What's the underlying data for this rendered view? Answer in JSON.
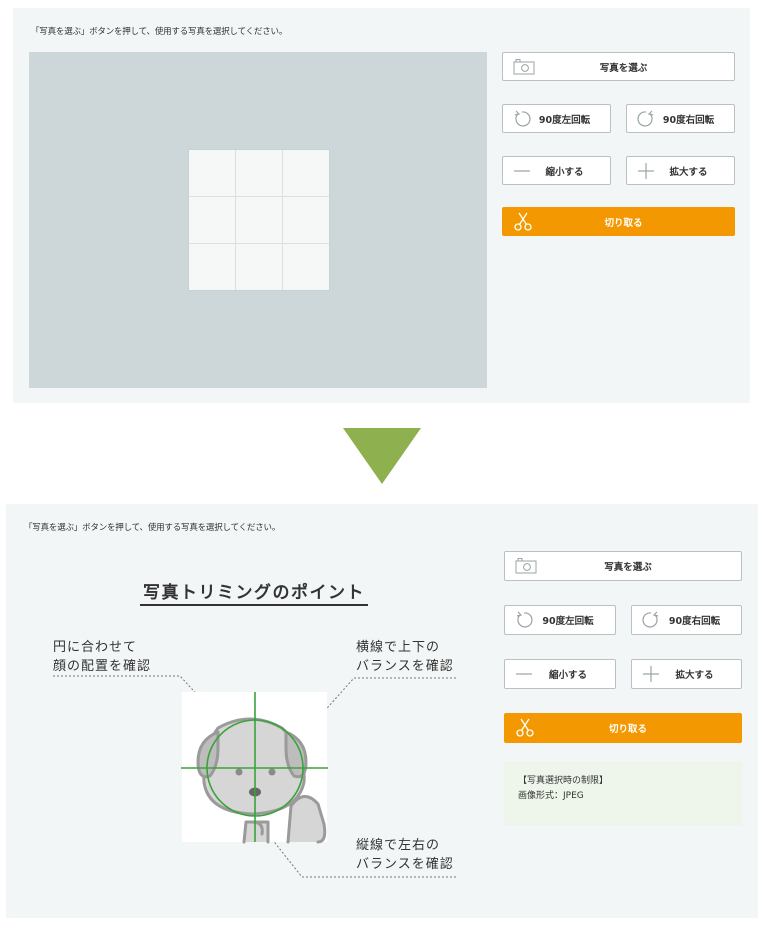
{
  "instruction": "「写真を選ぶ」ボタンを押して、使用する写真を選択してください。",
  "buttons": {
    "choose_photo": "写真を選ぶ",
    "rotate_left": "90度左回転",
    "rotate_right": "90度右回転",
    "shrink": "縮小する",
    "enlarge": "拡大する",
    "crop": "切り取る"
  },
  "guide": {
    "title": "写真トリミングのポイント",
    "note_face_1": "円に合わせて",
    "note_face_2": "顔の配置を確認",
    "note_horizontal_1": "横線で上下の",
    "note_horizontal_2": "バランスを確認",
    "note_vertical_1": "縦線で左右の",
    "note_vertical_2": "バランスを確認"
  },
  "restriction": {
    "heading": "【写真選択時の制限】",
    "format": "画像形式：JPEG"
  },
  "colors": {
    "accent_orange": "#f39800",
    "arrow_green": "#8fb04e",
    "guide_green": "#3aa33a",
    "panel_bg": "#f3f6f6",
    "crop_area_bg": "#cdd6d8",
    "restriction_bg": "#eef5ea"
  },
  "icons": {
    "choose_photo": "camera-icon",
    "rotate_left": "rotate-left-icon",
    "rotate_right": "rotate-right-icon",
    "shrink": "minus-icon",
    "enlarge": "plus-icon",
    "crop": "scissors-icon",
    "transition": "arrow-down-icon"
  }
}
